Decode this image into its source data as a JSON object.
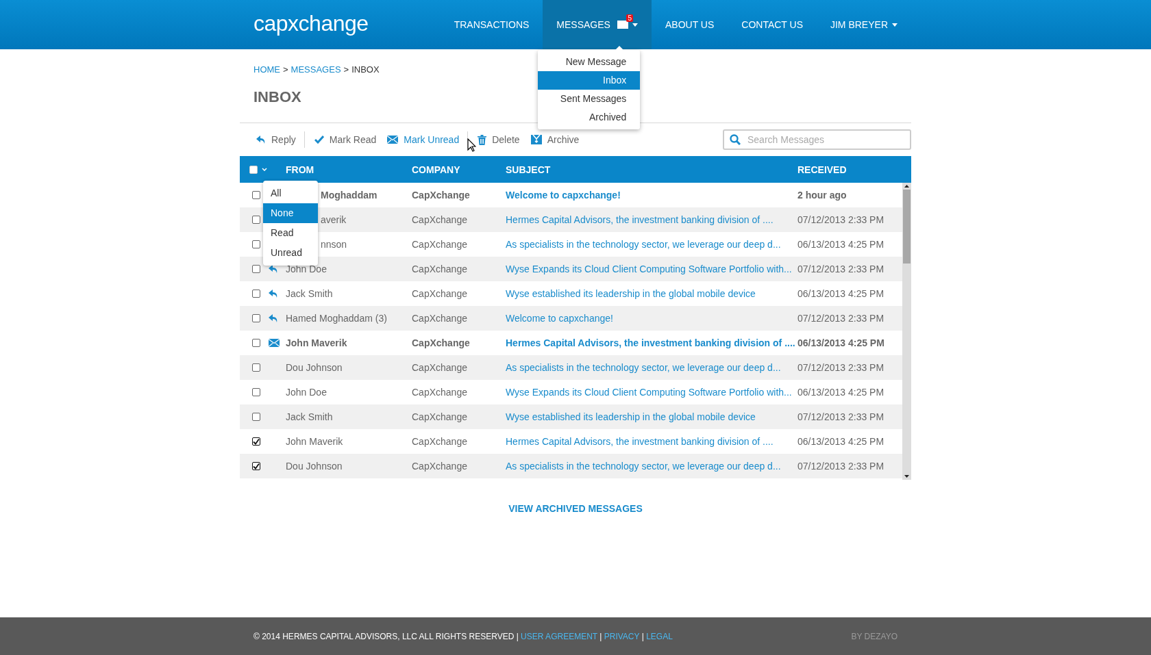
{
  "header": {
    "logo": "capxchange",
    "nav": [
      {
        "label": "TRANSACTIONS",
        "selected": false,
        "dropdown": false
      },
      {
        "label": "MESSAGES",
        "selected": true,
        "dropdown": true,
        "badge": "5"
      },
      {
        "label": "ABOUT US",
        "selected": false,
        "dropdown": false
      },
      {
        "label": "CONTACT US",
        "selected": false,
        "dropdown": false
      },
      {
        "label": "JIM BREYER",
        "selected": false,
        "dropdown": true
      }
    ],
    "messages_menu": [
      {
        "label": "New Message",
        "selected": false
      },
      {
        "label": "Inbox",
        "selected": true
      },
      {
        "label": "Sent Messages",
        "selected": false
      },
      {
        "label": "Archived",
        "selected": false
      }
    ]
  },
  "breadcrumb": [
    {
      "label": "HOME",
      "link": true
    },
    {
      "label": ">",
      "link": false
    },
    {
      "label": "MESSAGES",
      "link": true
    },
    {
      "label": ">",
      "link": false
    },
    {
      "label": "INBOX",
      "link": false
    }
  ],
  "page_title": "INBOX",
  "toolbar": [
    {
      "label": "Reply",
      "kind": "reply",
      "hovered": false,
      "divider_after": true
    },
    {
      "label": "Mark Read",
      "kind": "check",
      "hovered": false,
      "divider_after": false
    },
    {
      "label": "Mark Unread",
      "kind": "envelope",
      "hovered": true,
      "divider_after": true
    },
    {
      "label": "Delete",
      "kind": "trash",
      "hovered": false,
      "divider_after": false
    },
    {
      "label": "Archive",
      "kind": "archive",
      "hovered": false,
      "divider_after": false
    }
  ],
  "search": {
    "placeholder": "Search Messages"
  },
  "table": {
    "select_all": {
      "checked": false
    },
    "columns": [
      "FROM",
      "COMPANY",
      "SUBJECT",
      "RECEIVED"
    ],
    "select_menu": [
      {
        "label": "All",
        "selected": false
      },
      {
        "label": "None",
        "selected": true
      },
      {
        "label": "Read",
        "selected": false
      },
      {
        "label": "Unread",
        "selected": false
      }
    ],
    "rows": [
      {
        "checked": false,
        "kind": "plain",
        "unread": true,
        "from": "Moghaddam",
        "company": "CapXchange",
        "subject": "Welcome to capxchange!",
        "received": "2 hour ago"
      },
      {
        "checked": false,
        "kind": "plain",
        "unread": false,
        "from": "averik",
        "company": "CapXchange",
        "subject": "Hermes Capital Advisors, the investment banking division of ....",
        "received": "07/12/2013 2:33 PM"
      },
      {
        "checked": false,
        "kind": "plain",
        "unread": false,
        "from": "nnson",
        "company": "CapXchange",
        "subject": "As specialists in the technology sector, we leverage our deep d...",
        "received": "06/13/2013 4:25 PM"
      },
      {
        "checked": false,
        "kind": "reply",
        "unread": false,
        "from": "John Doe",
        "company": "CapXchange",
        "subject": "Wyse Expands its Cloud Client Computing Software Portfolio with...",
        "received": "07/12/2013 2:33 PM"
      },
      {
        "checked": false,
        "kind": "reply",
        "unread": false,
        "from": "Jack Smith",
        "company": "CapXchange",
        "subject": "Wyse established its leadership in the global mobile device",
        "received": "06/13/2013 4:25 PM"
      },
      {
        "checked": false,
        "kind": "reply",
        "unread": false,
        "from": "Hamed Moghaddam (3)",
        "company": "CapXchange",
        "subject": "Welcome to capxchange!",
        "received": "07/12/2013 2:33 PM"
      },
      {
        "checked": false,
        "kind": "envelope",
        "unread": true,
        "from": "John Maverik",
        "company": "CapXchange",
        "subject": "Hermes Capital Advisors, the investment banking division of ....",
        "received": "06/13/2013 4:25 PM"
      },
      {
        "checked": false,
        "kind": "plain",
        "unread": false,
        "from": "Dou Johnson",
        "company": "CapXchange",
        "subject": "As specialists in the technology sector, we leverage our deep d...",
        "received": "07/12/2013 2:33 PM"
      },
      {
        "checked": false,
        "kind": "plain",
        "unread": false,
        "from": "John Doe",
        "company": "CapXchange",
        "subject": "Wyse Expands its Cloud Client Computing Software Portfolio with...",
        "received": "06/13/2013 4:25 PM"
      },
      {
        "checked": false,
        "kind": "plain",
        "unread": false,
        "from": "Jack Smith",
        "company": "CapXchange",
        "subject": "Wyse established its leadership in the global mobile device",
        "received": "07/12/2013 2:33 PM"
      },
      {
        "checked": true,
        "kind": "plain",
        "unread": false,
        "from": "John Maverik",
        "company": "CapXchange",
        "subject": "Hermes Capital Advisors, the investment banking division of ....",
        "received": "06/13/2013 4:25 PM"
      },
      {
        "checked": true,
        "kind": "plain",
        "unread": false,
        "from": "Dou Johnson",
        "company": "CapXchange",
        "subject": "As specialists in the technology sector, we leverage our deep d...",
        "received": "07/12/2013 2:33 PM"
      }
    ]
  },
  "archived_link": "VIEW ARCHIVED MESSAGES",
  "footer": {
    "parts": [
      {
        "kind": "text",
        "text": "© 2014 HERMES CAPITAL ADVISORS, LLC ALL RIGHTS RESERVED |"
      },
      {
        "kind": "link",
        "text": "USER AGREEMENT"
      },
      {
        "kind": "text",
        "text": "|"
      },
      {
        "kind": "link",
        "text": "PRIVACY"
      },
      {
        "kind": "text",
        "text": "|"
      },
      {
        "kind": "link",
        "text": "LEGAL"
      }
    ],
    "credit": "BY DEZAYO"
  }
}
